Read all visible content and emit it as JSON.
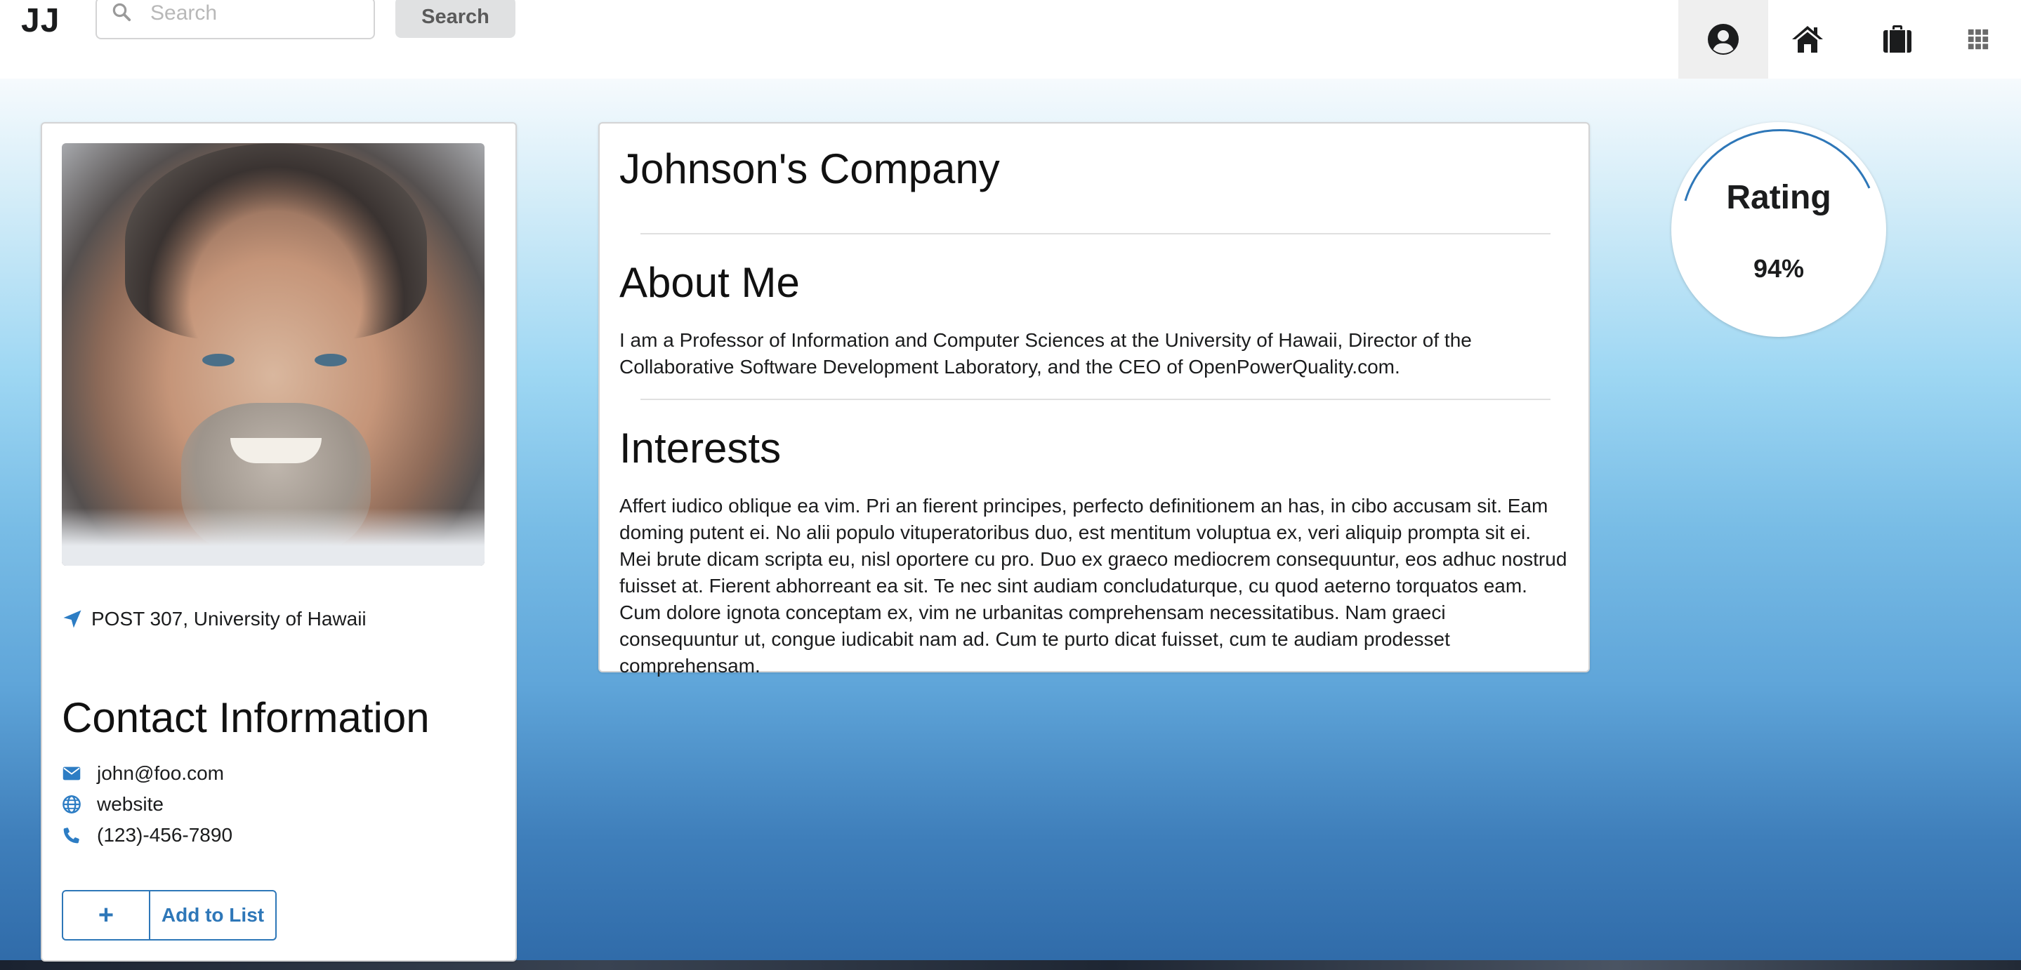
{
  "nav": {
    "brand": "JJ",
    "search_placeholder": "Search",
    "search_button": "Search",
    "icons": [
      "user-circle-icon",
      "home-icon",
      "briefcase-icon",
      "grid-icon"
    ],
    "active_item": "user-circle-icon"
  },
  "profile": {
    "location": "POST 307, University of Hawaii",
    "contact_title": "Contact Information",
    "email": "john@foo.com",
    "website": "website",
    "phone": "(123)-456-7890",
    "add_button_label": "Add to List",
    "add_button_icon": "+"
  },
  "main": {
    "company": "Johnson's Company",
    "about_title": "About Me",
    "about_text": "I am a Professor of Information and Computer Sciences at the University of Hawaii, Director of the Collaborative Software Development Laboratory, and the CEO of OpenPowerQuality.com.",
    "interests_title": "Interests",
    "interests_text": "Affert iudico oblique ea vim. Pri an fierent principes, perfecto definitionem an has, in cibo accusam sit. Eam doming putent ei. No alii populo vituperatoribus duo, est mentitum voluptua ex, veri aliquip prompta sit ei. Mei brute dicam scripta eu, nisl oportere cu pro. Duo ex graeco mediocrem consequuntur, eos adhuc nostrud fuisset at. Fierent abhorreant ea sit. Te nec sint audiam concludaturque, cu quod aeterno torquatos eam. Cum dolore ignota conceptam ex, vim ne urbanitas comprehensam necessitatibus. Nam graeci consequuntur ut, congue iudicabit nam ad. Cum te purto dicat fuisset, cum te audiam prodesset comprehensam."
  },
  "rating": {
    "label": "Rating",
    "value": "94%",
    "percent": 94
  },
  "colors": {
    "accent": "#2e77b8",
    "icon_blue": "#2d7dc4"
  }
}
